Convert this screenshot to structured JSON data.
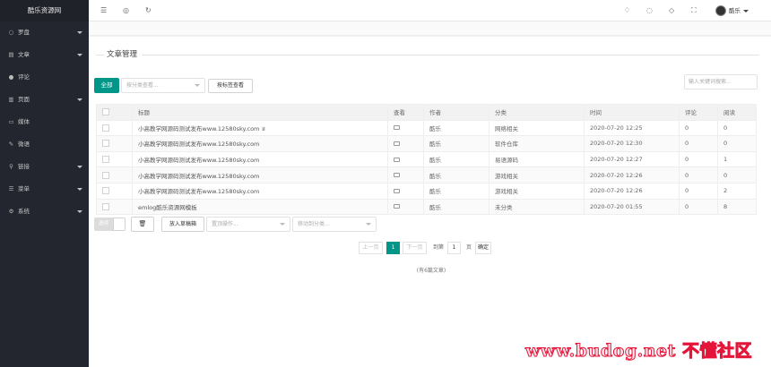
{
  "app": {
    "logo": "酷乐资源网"
  },
  "sidebar": {
    "items": [
      {
        "label": "罗盘",
        "icon": "○",
        "caret": true
      },
      {
        "label": "文章",
        "icon": "▤",
        "caret": true
      },
      {
        "label": "评论",
        "icon": "●",
        "caret": false
      },
      {
        "label": "页面",
        "icon": "▥",
        "caret": true
      },
      {
        "label": "媒体",
        "icon": "▭",
        "caret": false
      },
      {
        "label": "微语",
        "icon": "✎",
        "caret": false
      },
      {
        "label": "链接",
        "icon": "⚲",
        "caret": true
      },
      {
        "label": "菜单",
        "icon": "☰",
        "caret": true
      },
      {
        "label": "系统",
        "icon": "⚙",
        "caret": true
      }
    ]
  },
  "header": {
    "icons": {
      "menu": "☰",
      "web": "◎",
      "refresh": "↻",
      "bell": "♢",
      "theme": "◌",
      "tag": "◇",
      "fullscreen": "⛶"
    },
    "user": "酷乐"
  },
  "panel": {
    "legend": "文章管理",
    "all_button": "全部",
    "category_placeholder": "按分类查看...",
    "tag_button": "按标签查看",
    "search_placeholder": "输入关键词搜索..."
  },
  "table": {
    "headers": [
      "",
      "标题",
      "查看",
      "作者",
      "分类",
      "时间",
      "评论",
      "阅读"
    ],
    "rows": [
      {
        "title": "小高教学网源码测试发布www.12580sky.com",
        "pinned": true,
        "author": "酷乐",
        "category": "网络相关",
        "time": "2020-07-20 12:25",
        "comments": "0",
        "views": "0"
      },
      {
        "title": "小高教学网源码测试发布www.12580sky.com",
        "pinned": false,
        "author": "酷乐",
        "category": "软件仓库",
        "time": "2020-07-20 12:30",
        "comments": "0",
        "views": "0"
      },
      {
        "title": "小高教学网源码测试发布www.12580sky.com",
        "pinned": false,
        "author": "酷乐",
        "category": "易语源码",
        "time": "2020-07-20 12:27",
        "comments": "0",
        "views": "1"
      },
      {
        "title": "小高教学网源码测试发布www.12580sky.com",
        "pinned": false,
        "author": "酷乐",
        "category": "游戏相关",
        "time": "2020-07-20 12:26",
        "comments": "0",
        "views": "0"
      },
      {
        "title": "小高教学网源码测试发布www.12580sky.com",
        "pinned": false,
        "author": "酷乐",
        "category": "游戏相关",
        "time": "2020-07-20 12:26",
        "comments": "0",
        "views": "2"
      },
      {
        "title": "emlog酷乐资源网模板",
        "pinned": false,
        "author": "酷乐",
        "category": "未分类",
        "time": "2020-07-20 01:55",
        "comments": "0",
        "views": "8"
      }
    ]
  },
  "actions": {
    "toggle_label": "选项",
    "delete_icon": "🗑",
    "draft_button": "放入草稿箱",
    "action_placeholder": "置顶操作...",
    "move_placeholder": "移动到分类..."
  },
  "pagination": {
    "prev": "上一页",
    "current": "1",
    "next": "下一页",
    "goto_label": "到第",
    "goto_value": "1",
    "page_unit": "页",
    "confirm": "确定"
  },
  "summary": "(有6篇文章)",
  "watermark": "www.budog.net 不懂社区",
  "colors": {
    "accent": "#009688",
    "sidebar": "#23262e"
  }
}
